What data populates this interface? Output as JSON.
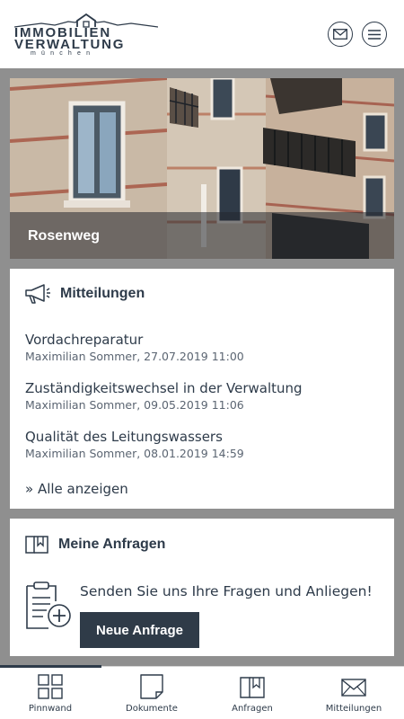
{
  "header": {
    "logo_line1": "IMMOBILIEN",
    "logo_line2": "VERWALTUNG",
    "logo_line3": "münchen",
    "mail_icon": "envelope-icon",
    "menu_icon": "hamburger-menu-icon"
  },
  "hero": {
    "label": "Rosenweg"
  },
  "messages": {
    "title": "Mitteilungen",
    "icon": "megaphone-icon",
    "items": [
      {
        "title": "Vordachreparatur",
        "meta": "Maximilian Sommer, 27.07.2019 11:00"
      },
      {
        "title": "Zuständigkeitswechsel in der Verwaltung",
        "meta": "Maximilian Sommer, 09.05.2019 11:06"
      },
      {
        "title": "Qualität des Leitungswassers",
        "meta": "Maximilian Sommer, 08.01.2019 14:59"
      }
    ],
    "show_all": "» Alle anzeigen"
  },
  "requests": {
    "title": "Meine Anfragen",
    "icon": "folder-bookmark-icon",
    "text": "Senden Sie uns Ihre Fragen und Anliegen!",
    "button": "Neue Anfrage",
    "clipboard_icon": "clipboard-add-icon"
  },
  "nav": {
    "items": [
      {
        "label": "Pinnwand",
        "icon": "grid-icon",
        "active": true
      },
      {
        "label": "Dokumente",
        "icon": "document-icon",
        "active": false
      },
      {
        "label": "Anfragen",
        "icon": "folder-icon",
        "active": false
      },
      {
        "label": "Mitteilungen",
        "icon": "envelope-icon",
        "active": false
      }
    ]
  }
}
